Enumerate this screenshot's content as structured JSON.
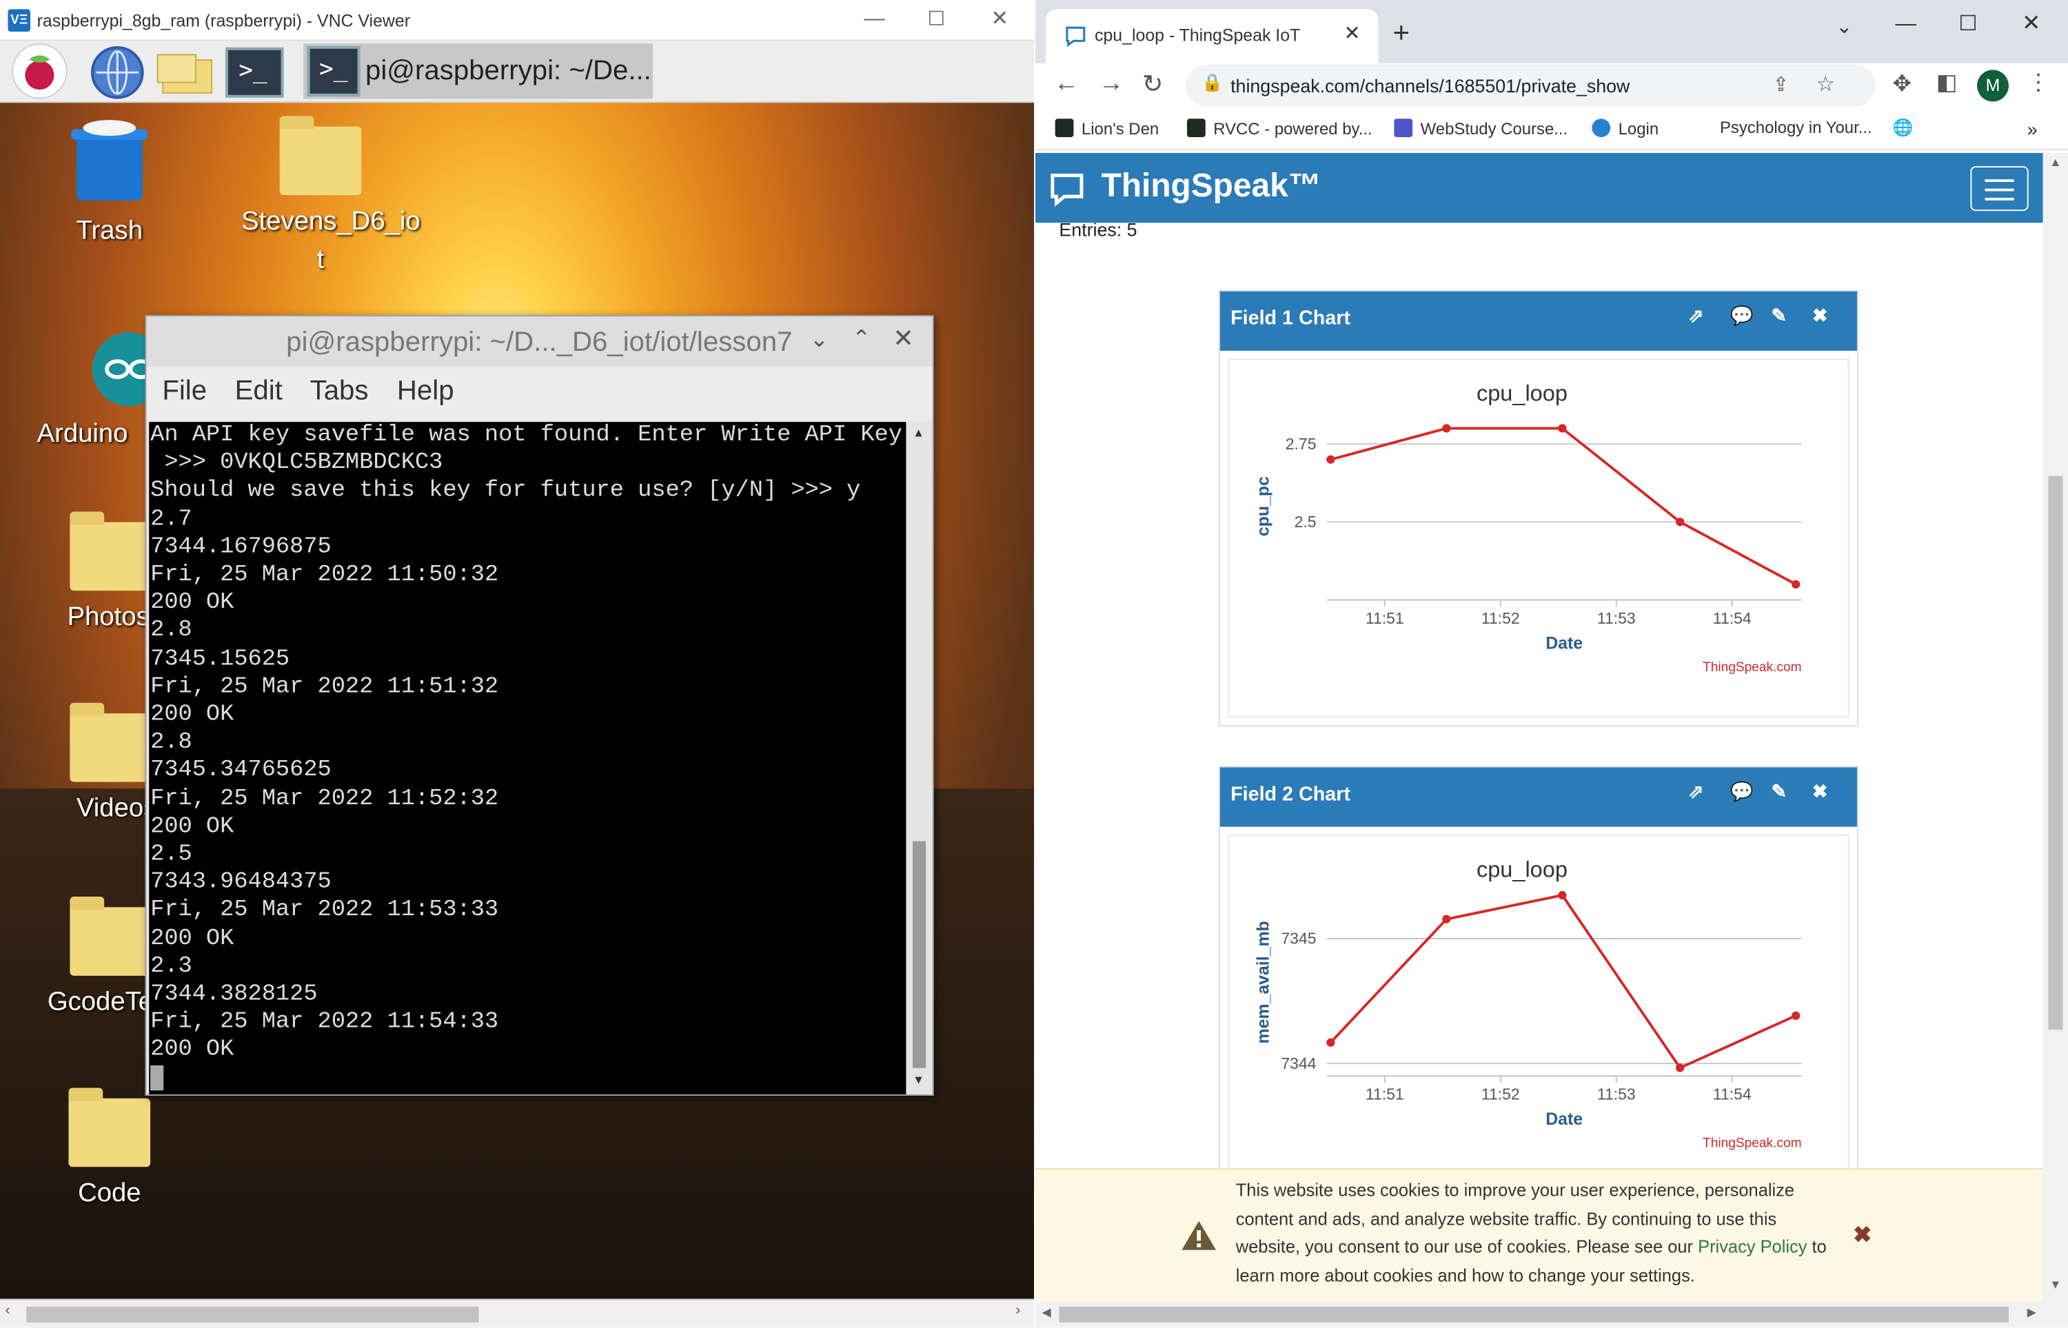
{
  "vnc": {
    "logo": "VΞ",
    "title": "raspberrypi_8gb_ram (raspberrypi) - VNC Viewer",
    "taskbar_terminal": "pi@raspberrypi: ~/De...",
    "desktop_icons": [
      "Trash",
      "Stevens_D6_io\nt",
      "Arduino",
      "Photos",
      "Videos",
      "GcodeTe",
      "Code"
    ]
  },
  "terminal": {
    "title": "pi@raspberrypi: ~/D..._D6_iot/iot/lesson7",
    "menu": [
      "File",
      "Edit",
      "Tabs",
      "Help"
    ],
    "lines": [
      "An API key savefile was not found. Enter Write API Key",
      " >>> 0VKQLC5BZMBDCKC3",
      "Should we save this key for future use? [y/N] >>> y",
      "2.7",
      "7344.16796875",
      "Fri, 25 Mar 2022 11:50:32",
      "200 OK",
      "2.8",
      "7345.15625",
      "Fri, 25 Mar 2022 11:51:32",
      "200 OK",
      "2.8",
      "7345.34765625",
      "Fri, 25 Mar 2022 11:52:32",
      "200 OK",
      "2.5",
      "7343.96484375",
      "Fri, 25 Mar 2022 11:53:33",
      "200 OK",
      "2.3",
      "7344.3828125",
      "Fri, 25 Mar 2022 11:54:33",
      "200 OK"
    ]
  },
  "browser": {
    "tab_title": "cpu_loop - ThingSpeak IoT",
    "url": "thingspeak.com/channels/1685501/private_show",
    "profile_initial": "M",
    "bookmarks": [
      "Lion's Den",
      "RVCC - powered by...",
      "WebStudy Course...",
      "Login",
      "Psychology in Your..."
    ],
    "more_bookmarks": "»"
  },
  "thingspeak": {
    "logo": "ThingSpeak™",
    "entries": "Entries: 5",
    "cookie_text_before": "This website uses cookies to improve your user experience, personalize content and ads, and analyze website traffic. By continuing to use this website, you consent to our use of cookies. Please see our ",
    "cookie_link": "Privacy Policy",
    "cookie_text_after": " to learn more about cookies and how to change your settings.",
    "cookie_close": "✖"
  },
  "colors": {
    "brand": "#2b7bb9",
    "series": "#d62728",
    "axis_text": "#2b5b8a"
  },
  "chart_data": [
    {
      "type": "line",
      "widget_title": "Field 1 Chart",
      "title": "cpu_loop",
      "xlabel": "Date",
      "ylabel": "cpu_pc",
      "x": [
        "11:50:32",
        "11:51:32",
        "11:52:32",
        "11:53:33",
        "11:54:33"
      ],
      "y": [
        2.7,
        2.8,
        2.8,
        2.5,
        2.3
      ],
      "ylim": [
        2.25,
        2.85
      ],
      "yticks": [
        "2.5",
        "2.75"
      ],
      "xticks": [
        "11:51",
        "11:52",
        "11:53",
        "11:54"
      ],
      "credit": "ThingSpeak.com"
    },
    {
      "type": "line",
      "widget_title": "Field 2 Chart",
      "title": "cpu_loop",
      "xlabel": "Date",
      "ylabel": "mem_avail_mb",
      "x": [
        "11:50:32",
        "11:51:32",
        "11:52:32",
        "11:53:33",
        "11:54:33"
      ],
      "y": [
        7344.16796875,
        7345.15625,
        7345.34765625,
        7343.96484375,
        7344.3828125
      ],
      "ylim": [
        7343.9,
        7345.4
      ],
      "yticks": [
        "7344",
        "7345"
      ],
      "xticks": [
        "11:51",
        "11:52",
        "11:53",
        "11:54"
      ],
      "credit": "ThingSpeak.com"
    }
  ]
}
